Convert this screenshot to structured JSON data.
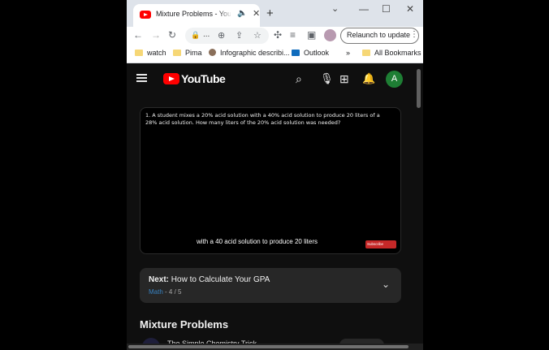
{
  "browser": {
    "tab": {
      "title": "Mixture Problems - YouTube"
    },
    "window_controls": {
      "minimize": "—",
      "maximize": "☐",
      "close": "✕"
    },
    "tab_controls": {
      "caret": "⌄",
      "new_tab": "+",
      "tab_close": "✕",
      "speaker": "🔈"
    },
    "toolbar": {
      "relaunch_label": "Relaunch to update",
      "omnibox_truncated": "..."
    },
    "bookmarks": [
      {
        "label": "watch",
        "icon": "folder-icon"
      },
      {
        "label": "Pima",
        "icon": "folder-icon"
      },
      {
        "label": "Infographic describi...",
        "icon": "profile-icon"
      },
      {
        "label": "Outlook",
        "icon": "outlook-icon"
      },
      {
        "label": "All Bookmarks",
        "icon": "folder-icon"
      }
    ],
    "bookmarks_overflow": "»"
  },
  "youtube": {
    "logo_text": "YouTube",
    "account_initial": "A",
    "video": {
      "problem_text": "1.  A student mixes a 20% acid solution with a 40% acid solution to produce 20 liters of a 28% acid solution.  How many liters of the 20% acid solution was needed?",
      "caption": "with a 40 acid solution to produce 20 liters",
      "subscribe_label": "Subscribe"
    },
    "next": {
      "prefix": "Next:",
      "title": "How to Calculate Your GPA",
      "playlist": "Math",
      "position": " - 4 / 5"
    },
    "playlist_title": "Mixture Problems",
    "peek_text": "The Simple Chemistry Trick..."
  }
}
